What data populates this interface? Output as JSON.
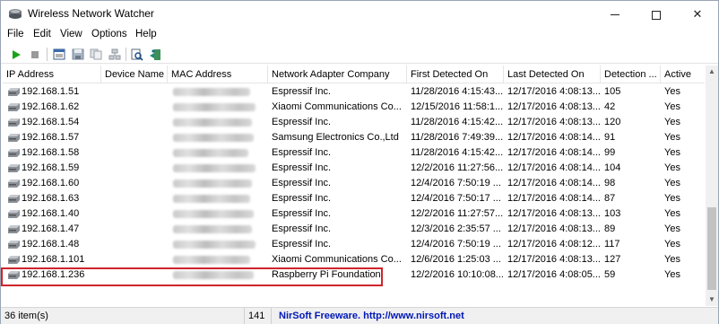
{
  "window": {
    "title": "Wireless Network Watcher",
    "minimize_glyph": "",
    "close_glyph": "✕"
  },
  "menu": [
    "File",
    "Edit",
    "View",
    "Options",
    "Help"
  ],
  "toolbar": {
    "icons": [
      "play-icon",
      "stop-icon",
      "properties-icon",
      "save-icon",
      "copy-icon",
      "network-icon",
      "search-icon",
      "exit-icon"
    ]
  },
  "columns": [
    "IP Address",
    "Device Name",
    "MAC Address",
    "Network Adapter Company",
    "First Detected On",
    "Last Detected On",
    "Detection ...",
    "Active"
  ],
  "rows": [
    {
      "ip": "192.168.1.51",
      "device": "",
      "company": "Espressif Inc.",
      "first": "11/28/2016 4:15:43...",
      "last": "12/17/2016 4:08:13...",
      "count": "105",
      "active": "Yes"
    },
    {
      "ip": "192.168.1.62",
      "device": "",
      "company": "Xiaomi Communications Co...",
      "first": "12/15/2016 11:58:1...",
      "last": "12/17/2016 4:08:13...",
      "count": "42",
      "active": "Yes"
    },
    {
      "ip": "192.168.1.54",
      "device": "",
      "company": "Espressif Inc.",
      "first": "11/28/2016 4:15:42...",
      "last": "12/17/2016 4:08:13...",
      "count": "120",
      "active": "Yes"
    },
    {
      "ip": "192.168.1.57",
      "device": "",
      "company": "Samsung Electronics Co.,Ltd",
      "first": "11/28/2016 7:49:39...",
      "last": "12/17/2016 4:08:14...",
      "count": "91",
      "active": "Yes"
    },
    {
      "ip": "192.168.1.58",
      "device": "",
      "company": "Espressif Inc.",
      "first": "11/28/2016 4:15:42...",
      "last": "12/17/2016 4:08:14...",
      "count": "99",
      "active": "Yes"
    },
    {
      "ip": "192.168.1.59",
      "device": "",
      "company": "Espressif Inc.",
      "first": "12/2/2016 11:27:56...",
      "last": "12/17/2016 4:08:14...",
      "count": "104",
      "active": "Yes"
    },
    {
      "ip": "192.168.1.60",
      "device": "",
      "company": "Espressif Inc.",
      "first": "12/4/2016 7:50:19 ...",
      "last": "12/17/2016 4:08:14...",
      "count": "98",
      "active": "Yes"
    },
    {
      "ip": "192.168.1.63",
      "device": "",
      "company": "Espressif Inc.",
      "first": "12/4/2016 7:50:17 ...",
      "last": "12/17/2016 4:08:14...",
      "count": "87",
      "active": "Yes"
    },
    {
      "ip": "192.168.1.40",
      "device": "",
      "company": "Espressif Inc.",
      "first": "12/2/2016 11:27:57...",
      "last": "12/17/2016 4:08:13...",
      "count": "103",
      "active": "Yes"
    },
    {
      "ip": "192.168.1.47",
      "device": "",
      "company": "Espressif Inc.",
      "first": "12/3/2016 2:35:57 ...",
      "last": "12/17/2016 4:08:13...",
      "count": "89",
      "active": "Yes"
    },
    {
      "ip": "192.168.1.48",
      "device": "",
      "company": "Espressif Inc.",
      "first": "12/4/2016 7:50:19 ...",
      "last": "12/17/2016 4:08:12...",
      "count": "117",
      "active": "Yes"
    },
    {
      "ip": "192.168.1.101",
      "device": "",
      "company": "Xiaomi Communications Co...",
      "first": "12/6/2016 1:25:03 ...",
      "last": "12/17/2016 4:08:13...",
      "count": "127",
      "active": "Yes"
    },
    {
      "ip": "192.168.1.236",
      "device": "",
      "company": "Raspberry Pi Foundation",
      "first": "12/2/2016 10:10:08...",
      "last": "12/17/2016 4:08:05...",
      "count": "59",
      "active": "Yes"
    }
  ],
  "status": {
    "items": "36 item(s)",
    "count": "141",
    "link": "NirSoft Freeware.  http://www.nirsoft.net"
  },
  "colors": {
    "highlight": "#d0242b",
    "link": "#0018b8"
  }
}
